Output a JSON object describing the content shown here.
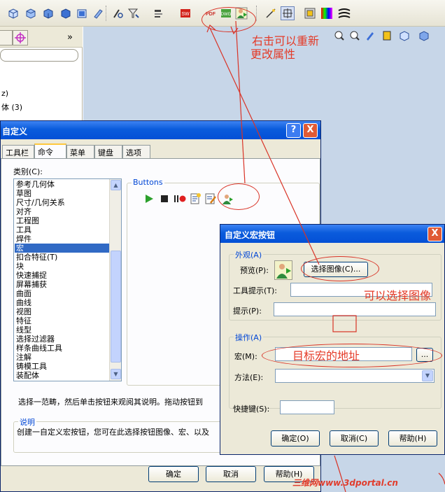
{
  "colors": {
    "titlebar": "#0a5bdc",
    "dialog_bg": "#ece9d8",
    "graphics_bg": "#c7d6e8",
    "selection": "#316ac5",
    "group_label": "#0046d5",
    "annotation": "#e43a27"
  },
  "toolbar": {
    "icons": [
      "view-front-icon",
      "view-back-icon",
      "view-left-icon",
      "view-right-icon",
      "view-top-icon",
      "view-iso-icon",
      "sketch-icon",
      "filter-icon",
      "layer-icon",
      "solidworks-icon",
      "pdf-icon",
      "dwg-icon",
      "macro-button-icon",
      "smart-dimension-icon",
      "sketch-pressed-icon",
      "appearance-icon",
      "color-icon",
      "zebra-icon"
    ]
  },
  "left_panel": {
    "tab_more": "»",
    "tree": [
      "z)",
      "体 (3)"
    ]
  },
  "customize_dialog": {
    "title": "自定义",
    "help": "?",
    "close": "X",
    "tabs": [
      "工具栏",
      "命令",
      "菜单",
      "键盘",
      "选项"
    ],
    "category_label": "类别(C):",
    "categories": [
      "参考几何体",
      "草图",
      "尺寸/几何关系",
      "对齐",
      "工程图",
      "工具",
      "焊件",
      "宏",
      "扣合特征(T)",
      "块",
      "快速捕捉",
      "屏幕捕获",
      "曲面",
      "曲线",
      "视图",
      "特征",
      "线型",
      "选择过滤器",
      "样条曲线工具",
      "注解",
      "铸模工具",
      "装配体"
    ],
    "selected_category": "宏",
    "buttons_group": "Buttons",
    "button_icons": [
      "run-macro-icon",
      "stop-macro-icon",
      "record-macro-icon",
      "new-macro-icon",
      "edit-macro-icon",
      "custom-macro-button-icon"
    ],
    "hint": "选择一范畴，然后单击按钮来观阅其说明。拖动按钮到",
    "description_group": "说明",
    "description": "创建一自定义宏按钮，您可在此选择按钮图像、宏、以及",
    "ok": "确定",
    "cancel": "取消",
    "help_button": "帮助(H)"
  },
  "macro_dialog": {
    "title": "自定义宏按钮",
    "close": "X",
    "appearance_group": "外观(A)",
    "preview_label": "预览(P):",
    "choose_image": "选择图像(C)...",
    "tooltip_label": "工具提示(T):",
    "tooltip_value": "",
    "prompt_label": "提示(P):",
    "prompt_value": "",
    "action_group": "操作(A)",
    "macro_label": "宏(M):",
    "macro_value": "",
    "browse": "...",
    "method_label": "方法(E):",
    "method_value": "",
    "shortcut_label": "快捷键(S):",
    "shortcut_value": "",
    "ok": "确定(O)",
    "cancel": "取消(C)",
    "help": "帮助(H)"
  },
  "annotations": {
    "right_click": "右击可以重新",
    "right_click_2": "更改属性",
    "choose_image": "可以选择图像",
    "macro_path": "目标宏的地址"
  },
  "watermark": "三维网www.3dportal.cn"
}
